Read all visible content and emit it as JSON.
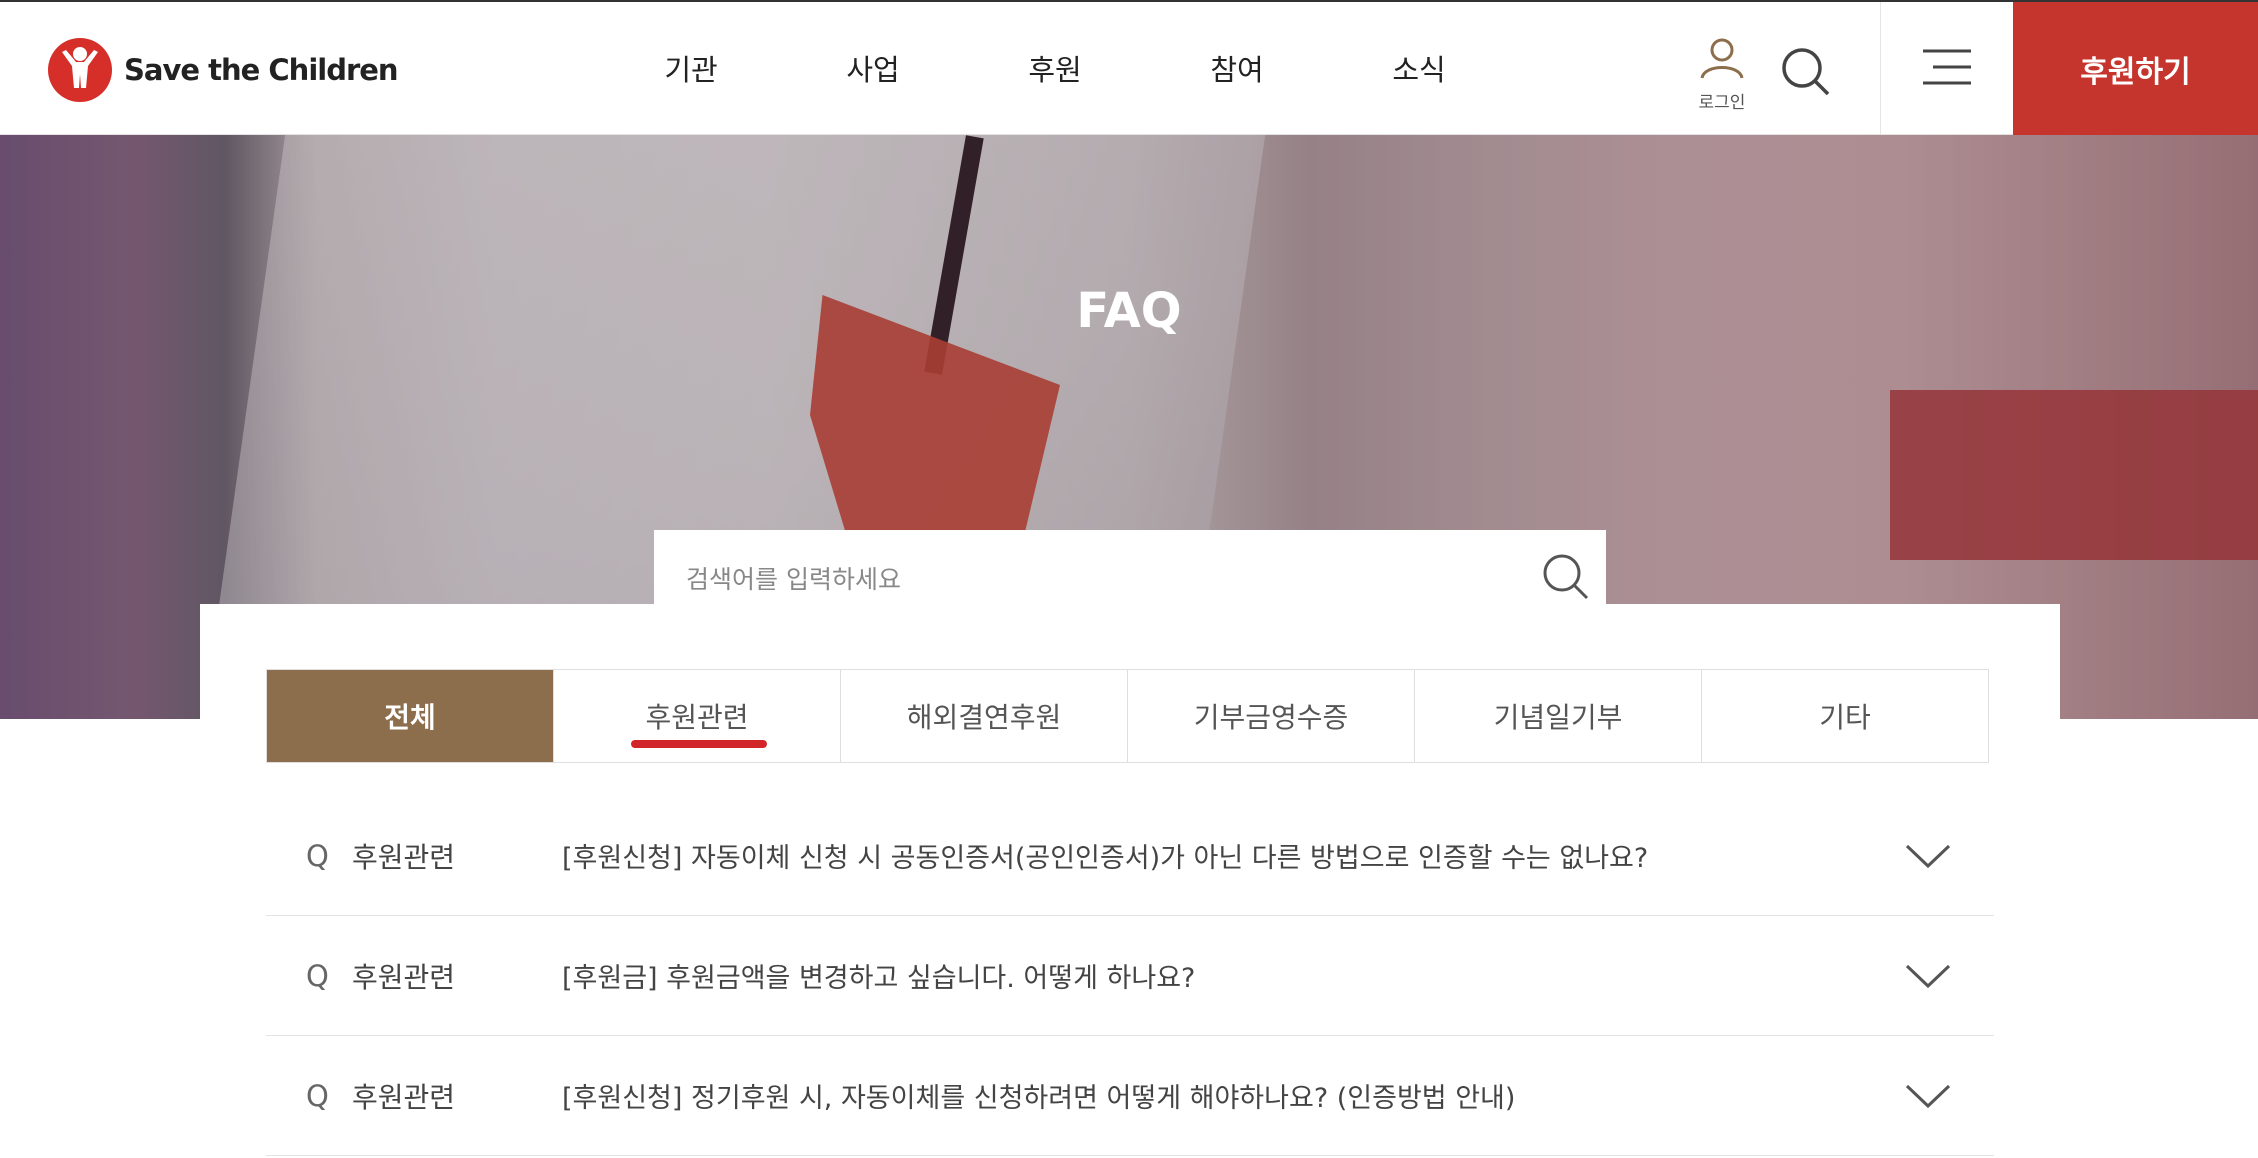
{
  "brand": {
    "name": "Save the Children",
    "accent_color": "#c5352e",
    "tab_active_color": "#8d6e4c"
  },
  "nav": {
    "items": [
      "기관",
      "사업",
      "후원",
      "참여",
      "소식"
    ],
    "login_label": "로그인",
    "search_icon": "search-icon",
    "menu_icon": "hamburger-icon",
    "donate_label": "후원하기"
  },
  "hero": {
    "title": "FAQ",
    "search_placeholder": "검색어를 입력하세요"
  },
  "tabs": [
    {
      "label": "전체",
      "active": true
    },
    {
      "label": "후원관련",
      "active": false,
      "hover": true
    },
    {
      "label": "해외결연후원",
      "active": false
    },
    {
      "label": "기부금영수증",
      "active": false
    },
    {
      "label": "기념일기부",
      "active": false
    },
    {
      "label": "기타",
      "active": false
    }
  ],
  "faq": [
    {
      "q": "Q",
      "category": "후원관련",
      "text": "[후원신청] 자동이체 신청 시 공동인증서(공인인증서)가 아닌 다른 방법으로 인증할 수는 없나요?"
    },
    {
      "q": "Q",
      "category": "후원관련",
      "text": "[후원금] 후원금액을 변경하고 싶습니다. 어떻게 하나요?"
    },
    {
      "q": "Q",
      "category": "후원관련",
      "text": "[후원신청] 정기후원 시, 자동이체를 신청하려면 어떻게 해야하나요? (인증방법 안내)"
    }
  ]
}
